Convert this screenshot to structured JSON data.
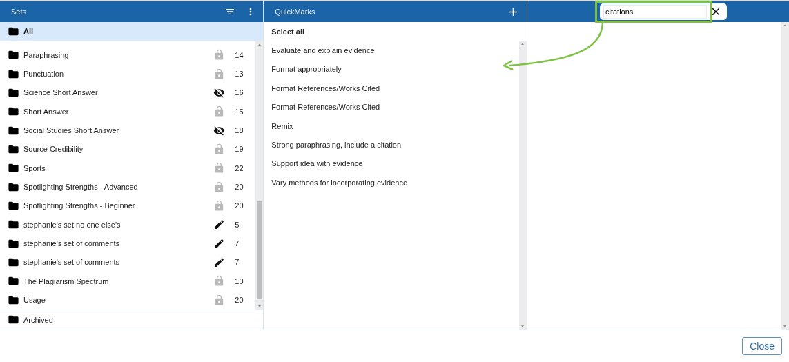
{
  "sets_panel": {
    "title": "Sets",
    "all_item": {
      "name": "All",
      "selected": true
    },
    "items": [
      {
        "name": "Paraphrasing",
        "kind": "locked",
        "count": "14",
        "selected": false
      },
      {
        "name": "Punctuation",
        "kind": "locked",
        "count": "13",
        "selected": false
      },
      {
        "name": "Science Short Answer",
        "kind": "hidden",
        "count": "16",
        "selected": false
      },
      {
        "name": "Short Answer",
        "kind": "locked",
        "count": "15",
        "selected": false
      },
      {
        "name": "Social Studies Short Answer",
        "kind": "hidden",
        "count": "18",
        "selected": false
      },
      {
        "name": "Source Credibility",
        "kind": "locked",
        "count": "19",
        "selected": false
      },
      {
        "name": "Sports",
        "kind": "locked",
        "count": "22",
        "selected": false
      },
      {
        "name": "Spotlighting Strengths - Advanced",
        "kind": "locked",
        "count": "20",
        "selected": false
      },
      {
        "name": "Spotlighting Strengths - Beginner",
        "kind": "locked",
        "count": "20",
        "selected": false
      },
      {
        "name": "stephanie's set no one else's",
        "kind": "editable",
        "count": "5",
        "selected": false
      },
      {
        "name": "stephanie's set of comments",
        "kind": "editable",
        "count": "7",
        "selected": false
      },
      {
        "name": "stephanie's set of comments",
        "kind": "editable",
        "count": "7",
        "selected": false
      },
      {
        "name": "The Plagiarism Spectrum",
        "kind": "locked",
        "count": "10",
        "selected": false
      },
      {
        "name": "Usage",
        "kind": "locked",
        "count": "20",
        "selected": false
      }
    ],
    "archived_item": {
      "name": "Archived",
      "selected": false
    }
  },
  "quickmarks_panel": {
    "title": "QuickMarks",
    "select_all": "Select all",
    "items": [
      "Evaluate and explain evidence",
      "Format appropriately",
      "Format References/Works Cited",
      "Format References/Works Cited",
      "Remix",
      "Strong paraphrasing, include a citation",
      "Support idea with evidence",
      "Vary methods for incorporating evidence"
    ]
  },
  "search": {
    "value": "citations"
  },
  "footer": {
    "close_button": "Close"
  }
}
